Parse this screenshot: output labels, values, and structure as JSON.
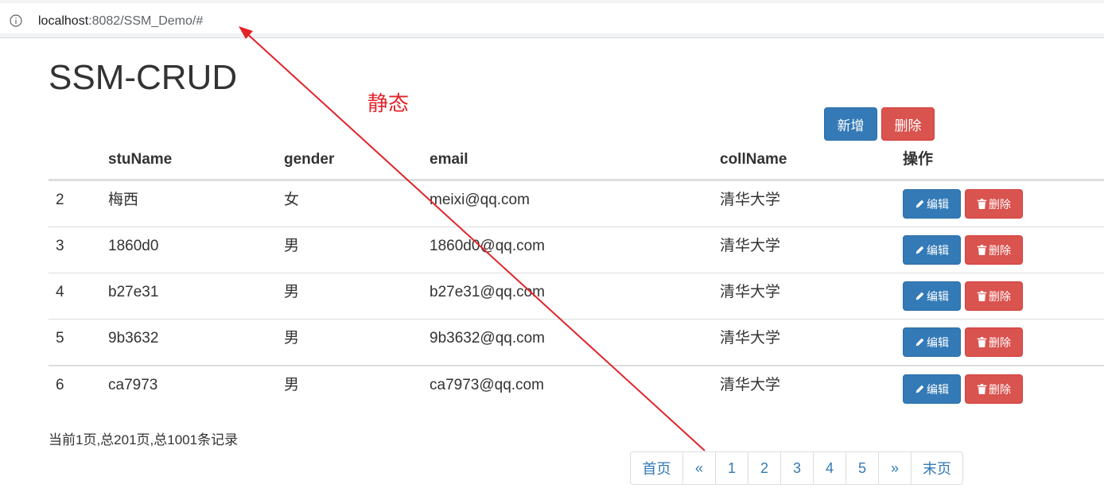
{
  "browser": {
    "url_host": "localhost",
    "url_rest": ":8082/SSM_Demo/#"
  },
  "page": {
    "title": "SSM-CRUD",
    "annotation": "静态"
  },
  "toolbar": {
    "add_label": "新增",
    "delete_label": "删除"
  },
  "table": {
    "headers": [
      "",
      "stuName",
      "gender",
      "email",
      "collName",
      "操作"
    ],
    "rows": [
      {
        "id": "2",
        "stuName": "梅西",
        "gender": "女",
        "email": "meixi@qq.com",
        "collName": "清华大学"
      },
      {
        "id": "3",
        "stuName": "1860d0",
        "gender": "男",
        "email": "1860d0@qq.com",
        "collName": "清华大学"
      },
      {
        "id": "4",
        "stuName": "b27e31",
        "gender": "男",
        "email": "b27e31@qq.com",
        "collName": "清华大学"
      },
      {
        "id": "5",
        "stuName": "9b3632",
        "gender": "男",
        "email": "9b3632@qq.com",
        "collName": "清华大学"
      },
      {
        "id": "6",
        "stuName": "ca7973",
        "gender": "男",
        "email": "ca7973@qq.com",
        "collName": "清华大学"
      }
    ],
    "edit_label": "编辑",
    "row_delete_label": "删除"
  },
  "pagination": {
    "info": "当前1页,总201页,总1001条记录",
    "items": [
      "首页",
      "«",
      "1",
      "2",
      "3",
      "4",
      "5",
      "»",
      "末页"
    ]
  },
  "colors": {
    "primary": "#337ab7",
    "danger": "#d9534f",
    "annotation": "#e1242a"
  }
}
